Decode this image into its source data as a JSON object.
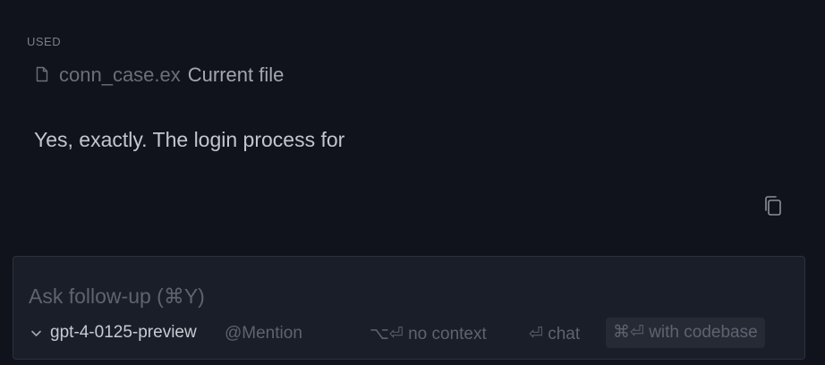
{
  "context": {
    "section_label": "USED",
    "file_name": "conn_case.ex",
    "file_tag": "Current file",
    "file_icon": "document-icon"
  },
  "message": {
    "text": "Yes, exactly. The login process for",
    "copy_icon": "copy-icon"
  },
  "composer": {
    "placeholder": "Ask follow-up (⌘Y)",
    "model": "gpt-4-0125-preview",
    "mention_label": "@Mention",
    "shortcuts": {
      "no_context": "⌥⏎ no context",
      "chat": "⏎ chat",
      "codebase": "⌘⏎ with codebase"
    }
  },
  "colors": {
    "background": "#10131b",
    "composer_bg": "#1a1e28",
    "text_primary": "#c2c6cf",
    "text_muted": "#5e6370"
  }
}
